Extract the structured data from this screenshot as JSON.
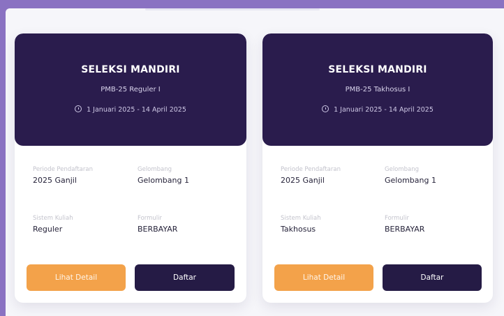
{
  "cards": [
    {
      "title": "SELEKSI MANDIRI",
      "subtitle": "PMB-25 Reguler I",
      "date_range": "1 Januari 2025 - 14 April 2025",
      "periode_label": "Periode Pendaftaran",
      "periode_value": "2025 Ganjil",
      "gelombang_label": "Gelombang",
      "gelombang_value": "Gelombang 1",
      "sistem_label": "Sistem Kuliah",
      "sistem_value": "Reguler",
      "formulir_label": "Formulir",
      "formulir_value": "BERBAYAR",
      "detail_button": "Lihat Detail",
      "register_button": "Daftar"
    },
    {
      "title": "SELEKSI MANDIRI",
      "subtitle": "PMB-25 Takhosus I",
      "date_range": "1 Januari 2025 - 14 April 2025",
      "periode_label": "Periode Pendaftaran",
      "periode_value": "2025 Ganjil",
      "gelombang_label": "Gelombang",
      "gelombang_value": "Gelombang 1",
      "sistem_label": "Sistem Kuliah",
      "sistem_value": "Takhosus",
      "formulir_label": "Formulir",
      "formulir_value": "BERBAYAR",
      "detail_button": "Lihat Detail",
      "register_button": "Daftar"
    }
  ],
  "colors": {
    "frame": "#8a72c2",
    "card_header": "#2a1c4d",
    "detail_button": "#f3a24a",
    "register_button": "#251b45"
  },
  "icons": {
    "date": "clock-icon"
  }
}
